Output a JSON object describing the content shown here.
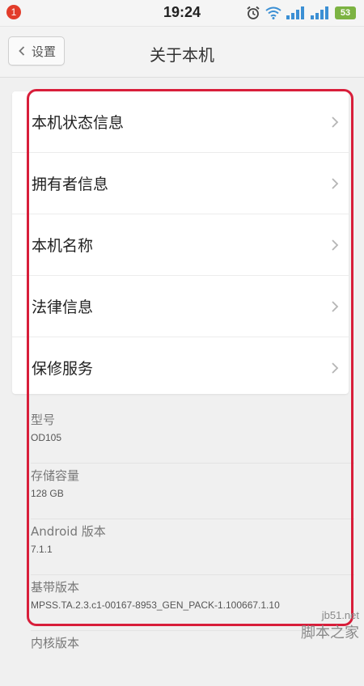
{
  "status_bar": {
    "notification_count": "1",
    "time": "19:24",
    "battery": "53"
  },
  "header": {
    "back_label": "设置",
    "title": "关于本机"
  },
  "menu": {
    "items": [
      {
        "label": "本机状态信息"
      },
      {
        "label": "拥有者信息"
      },
      {
        "label": "本机名称"
      },
      {
        "label": "法律信息"
      },
      {
        "label": "保修服务"
      }
    ]
  },
  "info": {
    "items": [
      {
        "label": "型号",
        "value": "OD105"
      },
      {
        "label": "存储容量",
        "value": "128 GB"
      },
      {
        "label": "Android 版本",
        "value": "7.1.1"
      },
      {
        "label": "基带版本",
        "value": "MPSS.TA.2.3.c1-00167-8953_GEN_PACK-1.100667.1.10"
      },
      {
        "label": "内核版本",
        "value": ""
      }
    ]
  },
  "watermark": {
    "line1": "jb51.net",
    "line2": "脚本之家"
  },
  "colors": {
    "highlight": "#d81e3a",
    "badge": "#e23c2a",
    "battery": "#7cb342",
    "signal": "#3b8fd4"
  }
}
